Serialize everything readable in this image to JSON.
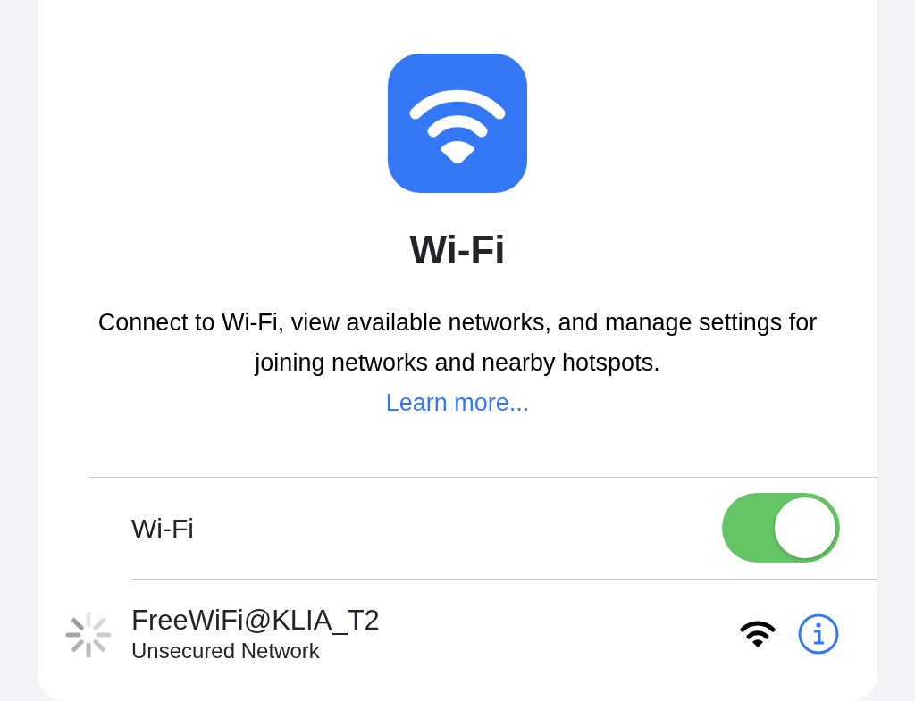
{
  "title": "Wi-Fi",
  "description": "Connect to Wi-Fi, view available networks, and manage settings for joining networks and nearby hotspots.",
  "link": "Learn more...",
  "wifi_toggle": {
    "label": "Wi-Fi",
    "on": true
  },
  "networks": [
    {
      "name": "FreeWiFi@KLIA_T2",
      "subtitle": "Unsecured Network",
      "connecting": true
    }
  ]
}
